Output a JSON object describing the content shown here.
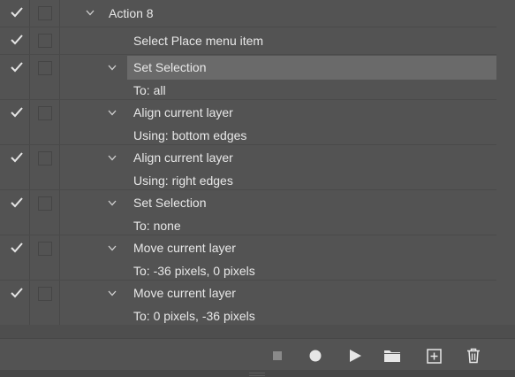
{
  "action_list": {
    "items": [
      {
        "label": "Action 8",
        "expanded": true
      },
      {
        "label": "Select Place menu item"
      },
      {
        "label": "Set Selection",
        "detail": "To: all",
        "selected": true
      },
      {
        "label": "Align current layer",
        "detail": "Using: bottom edges"
      },
      {
        "label": "Align current layer",
        "detail": "Using: right edges"
      },
      {
        "label": "Set Selection",
        "detail": "To: none"
      },
      {
        "label": "Move current layer",
        "detail": "To: -36 pixels, 0 pixels"
      },
      {
        "label": "Move current layer",
        "detail": "To: 0 pixels, -36 pixels"
      }
    ]
  },
  "toolbar": {
    "buttons": [
      {
        "icon": "stop-icon"
      },
      {
        "icon": "record-icon"
      },
      {
        "icon": "play-icon"
      },
      {
        "icon": "folder-icon"
      },
      {
        "icon": "new-action-icon"
      },
      {
        "icon": "trash-icon"
      }
    ]
  },
  "colors": {
    "panel_bg": "#535353",
    "selected_bg": "#6a6a6a",
    "text": "#e8e8e8",
    "icon": "#e6e6e6"
  }
}
